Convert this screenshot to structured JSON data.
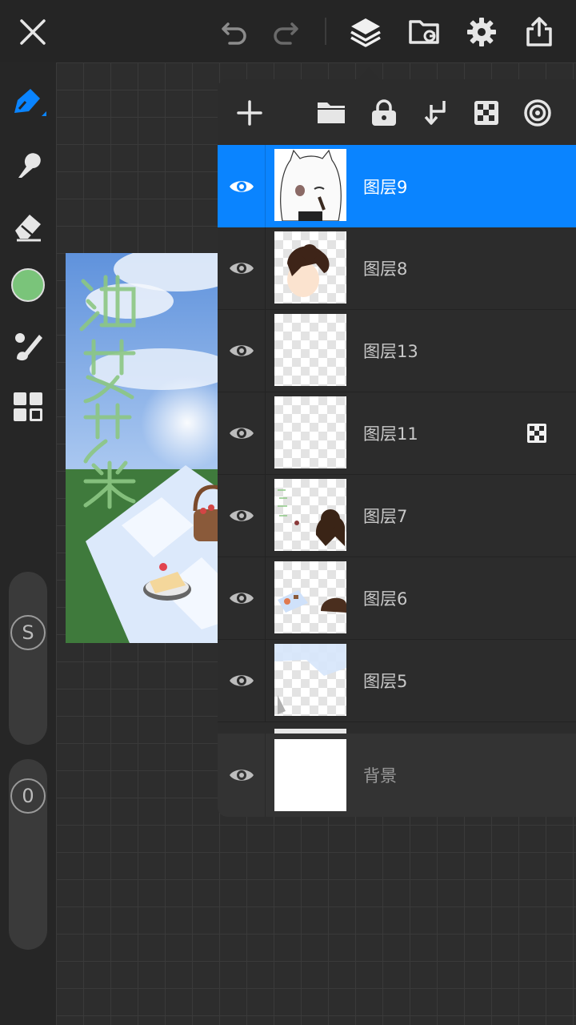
{
  "topbar": {
    "close": "close-icon",
    "undo": "undo-icon",
    "redo": "redo-icon",
    "layers": "layers-icon",
    "gallery": "folder-sync-icon",
    "settings": "gear-icon",
    "share": "share-icon"
  },
  "tools": {
    "pen": "pen-icon",
    "smudge": "smudge-icon",
    "eraser": "eraser-icon",
    "color": "#7ac47a",
    "brush_settings": "brush-icon",
    "grid_menu": "grid-icon",
    "size_slider_label": "S",
    "opacity_slider_label": "0"
  },
  "artwork": {
    "title_text": "油麦芋米",
    "colors": {
      "sky": "#6d9be0",
      "grass": "#3f7a3c",
      "cloth": "#dce9fb"
    }
  },
  "layers_panel": {
    "actions": [
      "add-icon",
      "folder-icon",
      "lock-icon",
      "merge-down-icon",
      "alpha-lock-icon",
      "clipping-icon"
    ],
    "layers": [
      {
        "name": "图层9",
        "selected": true,
        "visible": true,
        "alpha_lock": false
      },
      {
        "name": "图层8",
        "selected": false,
        "visible": true,
        "alpha_lock": false
      },
      {
        "name": "图层13",
        "selected": false,
        "visible": true,
        "alpha_lock": false
      },
      {
        "name": "图层11",
        "selected": false,
        "visible": true,
        "alpha_lock": true
      },
      {
        "name": "图层7",
        "selected": false,
        "visible": true,
        "alpha_lock": false
      },
      {
        "name": "图层6",
        "selected": false,
        "visible": true,
        "alpha_lock": false
      },
      {
        "name": "图层5",
        "selected": false,
        "visible": true,
        "alpha_lock": false
      }
    ],
    "background": {
      "name": "背景",
      "visible": true
    }
  },
  "accent": "#0a84ff"
}
